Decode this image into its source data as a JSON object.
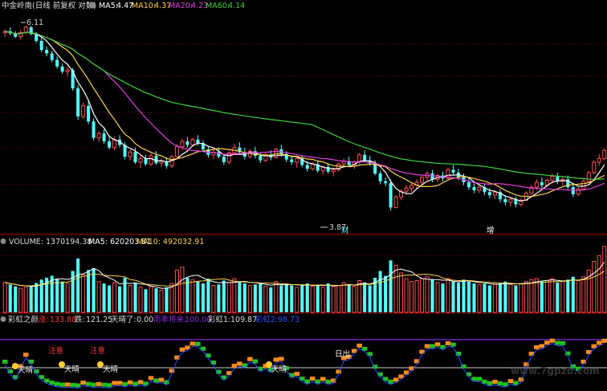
{
  "colors": {
    "up": "#ff3b3b",
    "up_hollow": "#ff5050",
    "down": "#54ffff",
    "ma5": "#ffffff",
    "ma10": "#ffd24a",
    "ma20": "#e040e0",
    "ma60": "#3ad23a",
    "grid": "#8b0000",
    "divider": "#b00000",
    "rainbow_orange": "#ff8c1a",
    "rainbow_green": "#1fc21f",
    "rainbow_line": "#3050ff",
    "ref_purple": "#8a2be2",
    "ref_white": "#cccccc"
  },
  "price_panel": {
    "title": "中金岭南(日线 前复权 对数)",
    "ma5_label": "MA5:",
    "ma5_value": "4.47",
    "ma10_label": "MA10:",
    "ma10_value": "4.37",
    "ma20_label": "MA20:",
    "ma20_value": "4.23",
    "ma60_label": "MA60:",
    "ma60_value": "4.14",
    "high_marker": "6.11",
    "low_marker": "3.87",
    "tag_cai": "财",
    "tag_zeng": "增"
  },
  "volume_panel": {
    "title": "VOLUME: 1370194.38",
    "ma5_label": "MA5: 620203.81",
    "ma10_label": "MA10: 492032.91"
  },
  "indicator_panel": {
    "name": "彩虹之颜",
    "rise_label": "涨:",
    "rise_value": "133.88",
    "fall_label": "跌:",
    "fall_value": "121.25",
    "sunny_label": "天晴了:",
    "sunny_value": "0.00",
    "rain_label": "雨季将来:",
    "rain_value": "100.00",
    "rainbow1_label": "彩虹1:",
    "rainbow1_value": "109.87",
    "rainbow2_label": "彩虹2:",
    "rainbow2_value": "98.73",
    "note_labels": [
      "注意",
      "注意"
    ],
    "sunny_markers": [
      "天晴",
      "天晴",
      "天晴",
      "天晴"
    ],
    "sunrise_label": "日出"
  },
  "watermark": "www.7gpzb.com",
  "chart_data": {
    "type": "candlestick",
    "title": "中金岭南(日线 前复权 对数)",
    "scale": "log",
    "ylim": [
      3.7,
      6.3
    ],
    "annotations": [
      {
        "label": "6.11",
        "type": "high"
      },
      {
        "label": "3.87",
        "type": "low"
      }
    ],
    "ohlc": [
      [
        6.0,
        6.05,
        5.94,
        6.02
      ],
      [
        6.02,
        6.08,
        5.96,
        5.99
      ],
      [
        5.99,
        6.02,
        5.92,
        5.94
      ],
      [
        5.94,
        6.04,
        5.9,
        6.0
      ],
      [
        6.0,
        6.11,
        5.97,
        6.08
      ],
      [
        6.08,
        6.1,
        5.96,
        5.98
      ],
      [
        5.98,
        6.01,
        5.85,
        5.88
      ],
      [
        5.88,
        5.93,
        5.72,
        5.75
      ],
      [
        5.75,
        5.8,
        5.66,
        5.7
      ],
      [
        5.7,
        5.74,
        5.58,
        5.61
      ],
      [
        5.61,
        5.66,
        5.49,
        5.52
      ],
      [
        5.52,
        5.56,
        5.42,
        5.45
      ],
      [
        5.45,
        5.52,
        5.38,
        5.47
      ],
      [
        5.47,
        5.5,
        5.2,
        5.23
      ],
      [
        5.23,
        5.27,
        4.84,
        4.88
      ],
      [
        4.88,
        5.05,
        4.85,
        5.01
      ],
      [
        5.01,
        5.08,
        4.79,
        4.82
      ],
      [
        4.82,
        4.86,
        4.6,
        4.63
      ],
      [
        4.63,
        4.71,
        4.58,
        4.68
      ],
      [
        4.68,
        4.73,
        4.56,
        4.59
      ],
      [
        4.59,
        4.64,
        4.5,
        4.52
      ],
      [
        4.52,
        4.65,
        4.49,
        4.61
      ],
      [
        4.61,
        4.66,
        4.52,
        4.55
      ],
      [
        4.55,
        4.58,
        4.39,
        4.42
      ],
      [
        4.42,
        4.5,
        4.38,
        4.47
      ],
      [
        4.47,
        4.52,
        4.34,
        4.36
      ],
      [
        4.36,
        4.44,
        4.3,
        4.4
      ],
      [
        4.4,
        4.44,
        4.32,
        4.34
      ],
      [
        4.34,
        4.46,
        4.32,
        4.43
      ],
      [
        4.43,
        4.48,
        4.33,
        4.35
      ],
      [
        4.35,
        4.4,
        4.31,
        4.37
      ],
      [
        4.37,
        4.41,
        4.29,
        4.32
      ],
      [
        4.32,
        4.44,
        4.3,
        4.42
      ],
      [
        4.42,
        4.56,
        4.41,
        4.53
      ],
      [
        4.53,
        4.62,
        4.49,
        4.59
      ],
      [
        4.59,
        4.64,
        4.52,
        4.55
      ],
      [
        4.55,
        4.63,
        4.53,
        4.61
      ],
      [
        4.61,
        4.66,
        4.54,
        4.57
      ],
      [
        4.57,
        4.6,
        4.47,
        4.5
      ],
      [
        4.5,
        4.54,
        4.41,
        4.44
      ],
      [
        4.44,
        4.5,
        4.39,
        4.47
      ],
      [
        4.47,
        4.52,
        4.4,
        4.42
      ],
      [
        4.42,
        4.45,
        4.33,
        4.36
      ],
      [
        4.36,
        4.48,
        4.34,
        4.46
      ],
      [
        4.46,
        4.56,
        4.44,
        4.52
      ],
      [
        4.52,
        4.58,
        4.44,
        4.47
      ],
      [
        4.47,
        4.52,
        4.39,
        4.42
      ],
      [
        4.42,
        4.5,
        4.4,
        4.48
      ],
      [
        4.48,
        4.53,
        4.4,
        4.43
      ],
      [
        4.43,
        4.47,
        4.35,
        4.38
      ],
      [
        4.38,
        4.46,
        4.36,
        4.44
      ],
      [
        4.44,
        4.49,
        4.38,
        4.41
      ],
      [
        4.41,
        4.52,
        4.4,
        4.5
      ],
      [
        4.5,
        4.55,
        4.42,
        4.45
      ],
      [
        4.45,
        4.48,
        4.36,
        4.39
      ],
      [
        4.39,
        4.43,
        4.33,
        4.36
      ],
      [
        4.36,
        4.42,
        4.3,
        4.4
      ],
      [
        4.4,
        4.44,
        4.31,
        4.33
      ],
      [
        4.33,
        4.37,
        4.26,
        4.29
      ],
      [
        4.29,
        4.36,
        4.27,
        4.34
      ],
      [
        4.34,
        4.38,
        4.25,
        4.27
      ],
      [
        4.27,
        4.33,
        4.23,
        4.31
      ],
      [
        4.31,
        4.35,
        4.24,
        4.26
      ],
      [
        4.26,
        4.3,
        4.21,
        4.28
      ],
      [
        4.28,
        4.36,
        4.26,
        4.34
      ],
      [
        4.34,
        4.4,
        4.3,
        4.37
      ],
      [
        4.37,
        4.42,
        4.31,
        4.33
      ],
      [
        4.33,
        4.38,
        4.29,
        4.36
      ],
      [
        4.36,
        4.46,
        4.34,
        4.44
      ],
      [
        4.44,
        4.49,
        4.36,
        4.38
      ],
      [
        4.38,
        4.43,
        4.32,
        4.35
      ],
      [
        4.35,
        4.38,
        4.22,
        4.24
      ],
      [
        4.24,
        4.27,
        4.13,
        4.16
      ],
      [
        4.16,
        4.2,
        4.11,
        4.14
      ],
      [
        4.14,
        4.18,
        3.87,
        3.9
      ],
      [
        3.9,
        4.02,
        3.89,
        4.0
      ],
      [
        4.0,
        4.08,
        3.97,
        4.06
      ],
      [
        4.06,
        4.12,
        4.02,
        4.09
      ],
      [
        4.09,
        4.14,
        4.05,
        4.12
      ],
      [
        4.12,
        4.18,
        4.08,
        4.15
      ],
      [
        4.15,
        4.22,
        4.12,
        4.2
      ],
      [
        4.2,
        4.27,
        4.17,
        4.24
      ],
      [
        4.24,
        4.28,
        4.15,
        4.18
      ],
      [
        4.18,
        4.24,
        4.15,
        4.22
      ],
      [
        4.22,
        4.26,
        4.16,
        4.19
      ],
      [
        4.19,
        4.3,
        4.18,
        4.28
      ],
      [
        4.28,
        4.33,
        4.22,
        4.25
      ],
      [
        4.25,
        4.29,
        4.17,
        4.2
      ],
      [
        4.2,
        4.24,
        4.12,
        4.15
      ],
      [
        4.15,
        4.19,
        4.07,
        4.1
      ],
      [
        4.1,
        4.14,
        4.04,
        4.07
      ],
      [
        4.07,
        4.12,
        4.04,
        4.1
      ],
      [
        4.1,
        4.13,
        4.02,
        4.05
      ],
      [
        4.05,
        4.09,
        3.99,
        4.02
      ],
      [
        4.02,
        4.07,
        3.98,
        4.05
      ],
      [
        4.05,
        4.08,
        3.95,
        3.98
      ],
      [
        3.98,
        4.02,
        3.92,
        3.95
      ],
      [
        3.95,
        4.0,
        3.91,
        3.98
      ],
      [
        3.98,
        4.01,
        3.9,
        3.93
      ],
      [
        3.93,
        3.99,
        3.91,
        3.97
      ],
      [
        3.97,
        4.06,
        3.96,
        4.04
      ],
      [
        4.04,
        4.12,
        4.02,
        4.1
      ],
      [
        4.1,
        4.18,
        4.07,
        4.15
      ],
      [
        4.15,
        4.2,
        4.09,
        4.12
      ],
      [
        4.12,
        4.19,
        4.1,
        4.17
      ],
      [
        4.17,
        4.24,
        4.14,
        4.21
      ],
      [
        4.21,
        4.25,
        4.13,
        4.16
      ],
      [
        4.16,
        4.21,
        4.11,
        4.18
      ],
      [
        4.18,
        4.22,
        4.08,
        4.1
      ],
      [
        4.1,
        4.14,
        4.0,
        4.03
      ],
      [
        4.03,
        4.1,
        4.01,
        4.08
      ],
      [
        4.08,
        4.18,
        4.07,
        4.16
      ],
      [
        4.16,
        4.27,
        4.14,
        4.25
      ],
      [
        4.25,
        4.38,
        4.23,
        4.36
      ],
      [
        4.36,
        4.45,
        4.32,
        4.4
      ],
      [
        4.4,
        4.51,
        4.38,
        4.49
      ]
    ],
    "ma5_last": 4.47,
    "ma10_last": 4.37,
    "ma20_last": 4.23,
    "ma60_last": 4.14,
    "volume": [
      620,
      580,
      540,
      500,
      520,
      560,
      610,
      680,
      720,
      760,
      700,
      640,
      600,
      860,
      1120,
      780,
      880,
      920,
      640,
      600,
      560,
      620,
      540,
      720,
      560,
      620,
      520,
      480,
      540,
      500,
      460,
      520,
      600,
      880,
      940,
      720,
      680,
      640,
      600,
      700,
      560,
      580,
      660,
      620,
      700,
      640,
      600,
      560,
      580,
      620,
      540,
      520,
      640,
      560,
      600,
      560,
      520,
      580,
      600,
      540,
      560,
      520,
      600,
      540,
      560,
      620,
      580,
      540,
      660,
      620,
      560,
      720,
      860,
      760,
      1080,
      980,
      820,
      700,
      640,
      660,
      700,
      740,
      680,
      620,
      600,
      700,
      640,
      620,
      680,
      640,
      600,
      580,
      600,
      560,
      580,
      600,
      640,
      580,
      560,
      600,
      640,
      680,
      700,
      640,
      660,
      700,
      620,
      640,
      680,
      740,
      660,
      740,
      880,
      1060,
      1180,
      1370
    ],
    "volume_last": 1370194.38,
    "volume_ma5_last": 620203.81,
    "volume_ma10_last": 492032.91,
    "indicator_last": {
      "涨": 133.88,
      "跌": 121.25,
      "天晴了": 0.0,
      "雨季将来": 100.0,
      "彩虹1": 109.87,
      "彩虹2": 98.73
    }
  }
}
